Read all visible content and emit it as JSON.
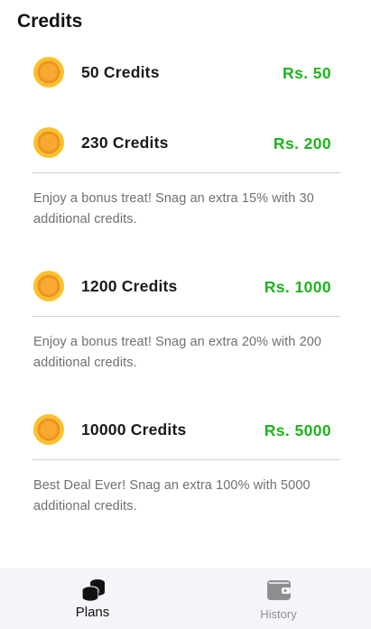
{
  "header": {
    "title": "Credits"
  },
  "plans": [
    {
      "label": "50 Credits",
      "price": "Rs. 50",
      "description": "",
      "icon": "coin-icon"
    },
    {
      "label": "230 Credits",
      "price": "Rs. 200",
      "description": "Enjoy a bonus treat! Snag an extra 15% with 30 additional credits.",
      "icon": "coin-icon"
    },
    {
      "label": "1200 Credits",
      "price": "Rs. 1000",
      "description": "Enjoy a bonus treat! Snag an extra 20% with 200 additional credits.",
      "icon": "coin-icon"
    },
    {
      "label": "10000 Credits",
      "price": "Rs. 5000",
      "description": "Best Deal Ever! Snag an extra 100% with 5000 additional credits.",
      "icon": "coin-icon"
    }
  ],
  "bottom_nav": {
    "items": [
      {
        "label": "Plans",
        "icon": "coins-stack-icon",
        "active": true
      },
      {
        "label": "History",
        "icon": "wallet-icon",
        "active": false
      }
    ]
  },
  "colors": {
    "price": "#1fb31f",
    "coin_outer": "#fbc02d",
    "coin_inner": "#f5a623",
    "nav_background": "#f4f5f9"
  }
}
